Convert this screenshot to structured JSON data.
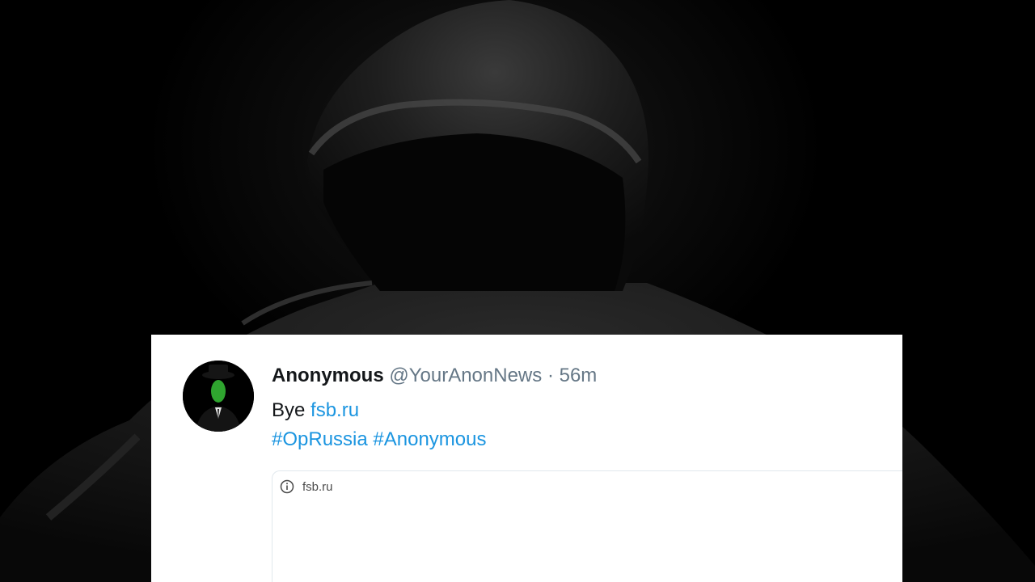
{
  "tweet": {
    "display_name": "Anonymous",
    "handle": "@YourAnonNews",
    "separator": "·",
    "time": "56m",
    "text_prefix": "Bye",
    "link_text": "fsb.ru",
    "hashtags": [
      "#OpRussia",
      "#Anonymous"
    ]
  },
  "link_preview": {
    "domain": "fsb.ru",
    "icon": "info-icon"
  },
  "colors": {
    "link": "#1b95e0",
    "secondary_text": "#657786",
    "primary_text": "#14171a"
  }
}
